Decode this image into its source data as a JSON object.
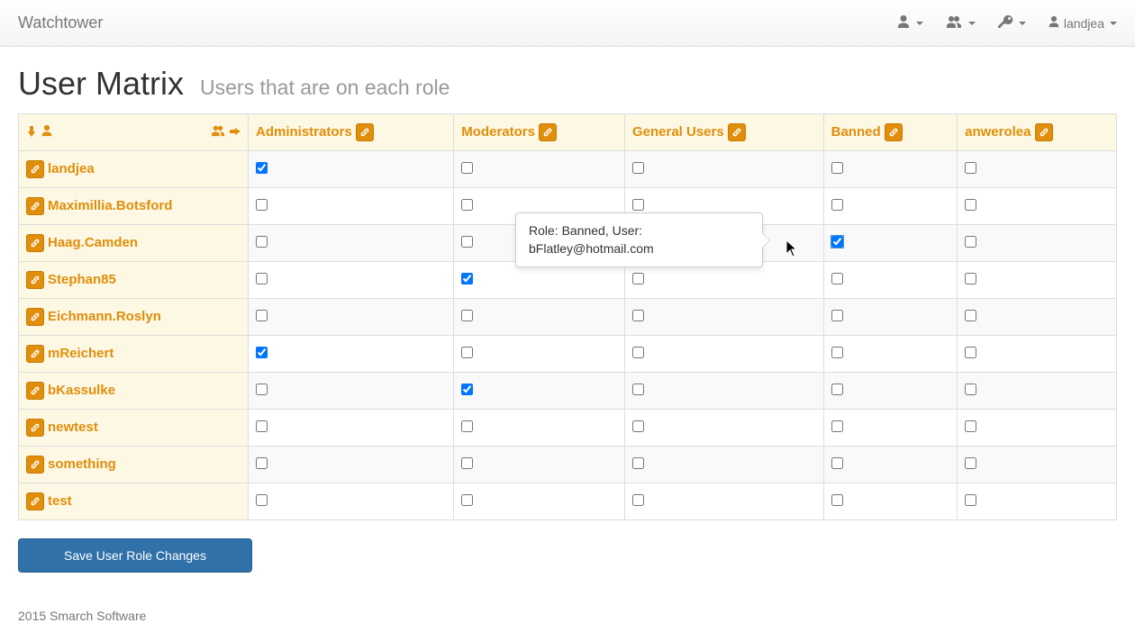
{
  "navbar": {
    "brand": "Watchtower",
    "user": "landjea"
  },
  "page": {
    "title": "User Matrix",
    "subtitle": "Users that are on each role"
  },
  "roles": [
    "Administrators",
    "Moderators",
    "General Users",
    "Banned",
    "anwerolea"
  ],
  "users": [
    {
      "name": "landjea",
      "checks": [
        true,
        false,
        false,
        false,
        false
      ]
    },
    {
      "name": "Maximillia.Botsford",
      "checks": [
        false,
        false,
        false,
        false,
        false
      ]
    },
    {
      "name": "Haag.Camden",
      "checks": [
        false,
        false,
        false,
        true,
        false
      ]
    },
    {
      "name": "Stephan85",
      "checks": [
        false,
        true,
        false,
        false,
        false
      ]
    },
    {
      "name": "Eichmann.Roslyn",
      "checks": [
        false,
        false,
        false,
        false,
        false
      ]
    },
    {
      "name": "mReichert",
      "checks": [
        true,
        false,
        false,
        false,
        false
      ]
    },
    {
      "name": "bKassulke",
      "checks": [
        false,
        true,
        false,
        false,
        false
      ]
    },
    {
      "name": "newtest",
      "checks": [
        false,
        false,
        false,
        false,
        false
      ]
    },
    {
      "name": "something",
      "checks": [
        false,
        false,
        false,
        false,
        false
      ]
    },
    {
      "name": "test",
      "checks": [
        false,
        false,
        false,
        false,
        false
      ]
    }
  ],
  "tooltip": {
    "text": "Role: Banned, User: bFlatley@hotmail.com",
    "row": 2,
    "col": 3
  },
  "buttons": {
    "save": "Save User Role Changes"
  },
  "footer": "2015 Smarch Software"
}
